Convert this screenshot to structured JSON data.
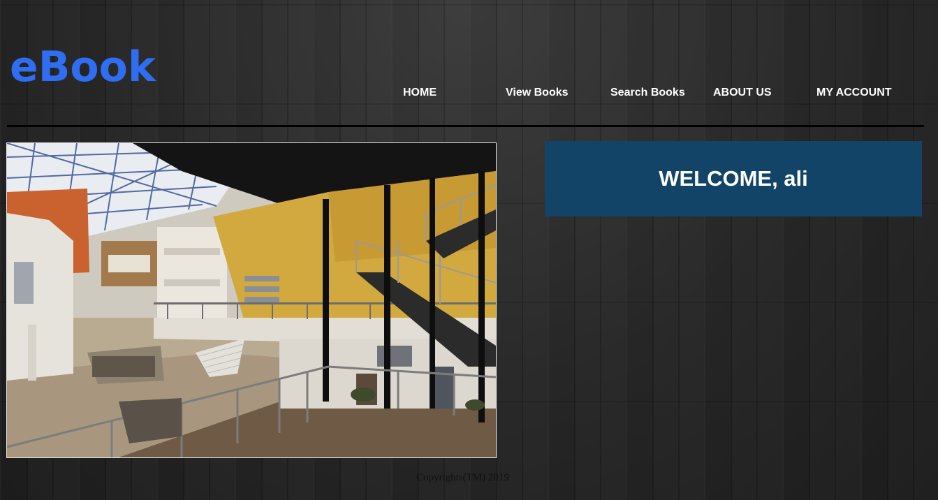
{
  "header": {
    "logo": "eBook"
  },
  "nav": {
    "home": "HOME",
    "view_books": "View Books",
    "search_books": "Search Books",
    "about_us": "ABOUT US",
    "my_account": "MY ACCOUNT"
  },
  "welcome": {
    "text": "WELCOME, ali"
  },
  "footer": {
    "copyright": "Copyrights(TM) 2019"
  },
  "colors": {
    "logo": "#2f6df2",
    "welcome_bg": "#114467",
    "nav_text": "#ffffff",
    "divider": "#000000"
  }
}
